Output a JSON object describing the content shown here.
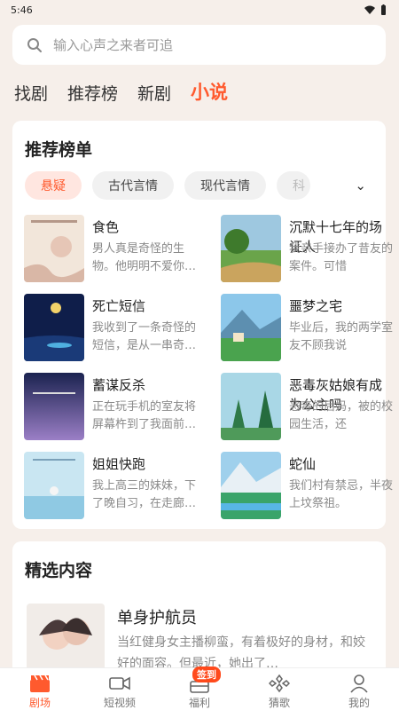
{
  "status": {
    "time": "5:46"
  },
  "search": {
    "placeholder": "输入心声之来者可追"
  },
  "top_tabs": [
    {
      "label": "找剧"
    },
    {
      "label": "推荐榜"
    },
    {
      "label": "新剧"
    },
    {
      "label": "小说"
    }
  ],
  "recommend": {
    "title": "推荐榜单",
    "chips": [
      "悬疑",
      "古代言情",
      "现代言情",
      "科"
    ],
    "books": [
      {
        "title": "食色",
        "desc": "男人真是奇怪的生物。他明明不爱你…"
      },
      {
        "title": "沉默十七年的场证人",
        "desc": "我亲手接办了昔友的案件。可惜"
      },
      {
        "title": "死亡短信",
        "desc": "我收到了一条奇怪的短信，是从一串奇…"
      },
      {
        "title": "噩梦之宅",
        "desc": "毕业后，我的两学室友不顾我说"
      },
      {
        "title": "蓄谋反杀",
        "desc": "正在玩手机的室友将屏幕杵到了我面前…"
      },
      {
        "title": "恶毒灰姑娘有成为公主吗",
        "desc": "恶毒的后妈，被的校园生活，还"
      },
      {
        "title": "姐姐快跑",
        "desc": "我上高三的妹妹，下了晚自习，在走廊…"
      },
      {
        "title": "蛇仙",
        "desc": "我们村有禁忌，半夜上坟祭祖。"
      }
    ]
  },
  "selected": {
    "title": "精选内容",
    "item": {
      "title": "单身护航员",
      "desc": "当红健身女主播柳蛮，有着极好的身材，和姣好的面容。但最近，她出了…"
    }
  },
  "nav": [
    {
      "label": "剧场"
    },
    {
      "label": "短视频"
    },
    {
      "label": "福利",
      "badge": "签到"
    },
    {
      "label": "猜歌"
    },
    {
      "label": "我的"
    }
  ],
  "colors": {
    "accent": "#ff5a2e",
    "background": "#f6efea"
  }
}
